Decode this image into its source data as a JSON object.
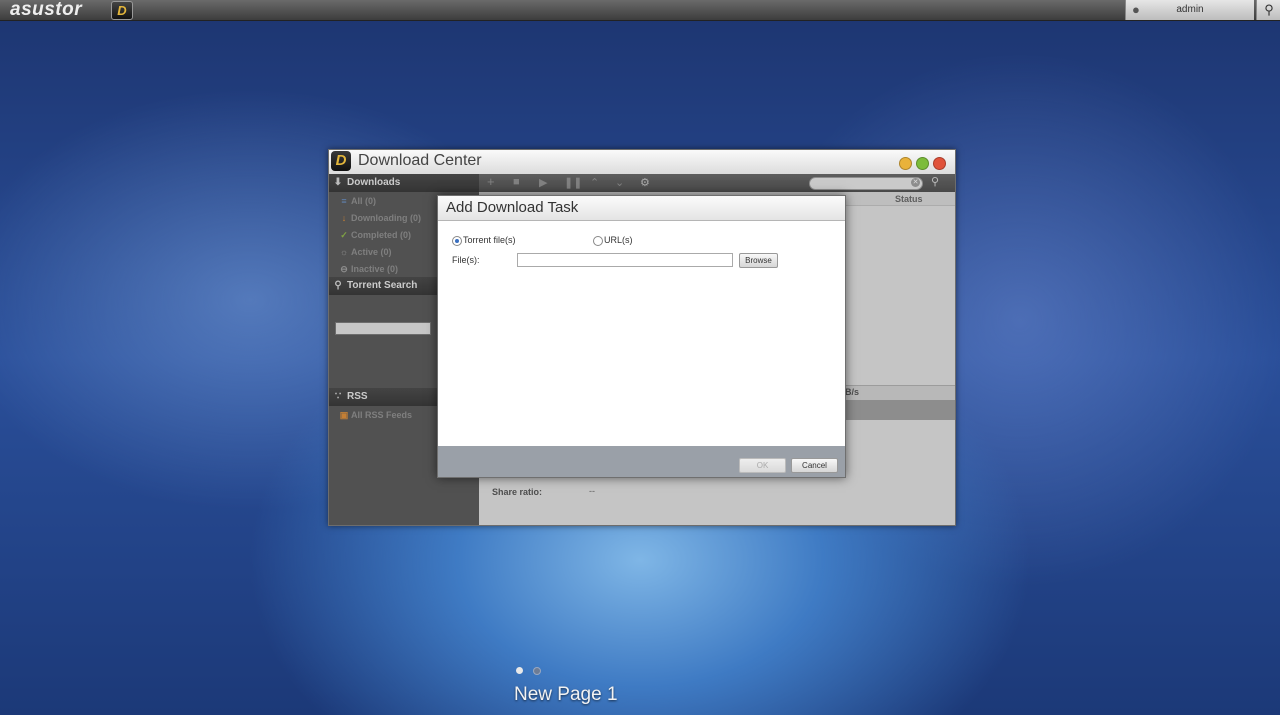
{
  "topbar": {
    "logo": "asustor",
    "app_icon": "download-center-icon",
    "user": "admin"
  },
  "window": {
    "title": "Download Center",
    "sidebar": {
      "downloads_header": "Downloads",
      "items": [
        {
          "label": "All (0)"
        },
        {
          "label": "Downloading (0)"
        },
        {
          "label": "Completed (0)"
        },
        {
          "label": "Active (0)"
        },
        {
          "label": "Inactive (0)"
        }
      ],
      "torrent_search_header": "Torrent Search",
      "rss_header": "RSS",
      "rss_items": [
        {
          "label": "All RSS Feeds"
        }
      ]
    },
    "content": {
      "status_column": "Status",
      "speed_fragment": "B/s",
      "share_ratio_label": "Share ratio:",
      "share_ratio_value": "--"
    }
  },
  "dialog": {
    "title": "Add Download Task",
    "option_torrent": "Torrent file(s)",
    "option_url": "URL(s)",
    "selected_option": "Torrent file(s)",
    "files_label": "File(s):",
    "files_value": "",
    "browse_label": "Browse",
    "ok_label": "OK",
    "cancel_label": "Cancel"
  },
  "desktop": {
    "page_label": "New Page 1",
    "pages": 2,
    "current_page": 1
  }
}
